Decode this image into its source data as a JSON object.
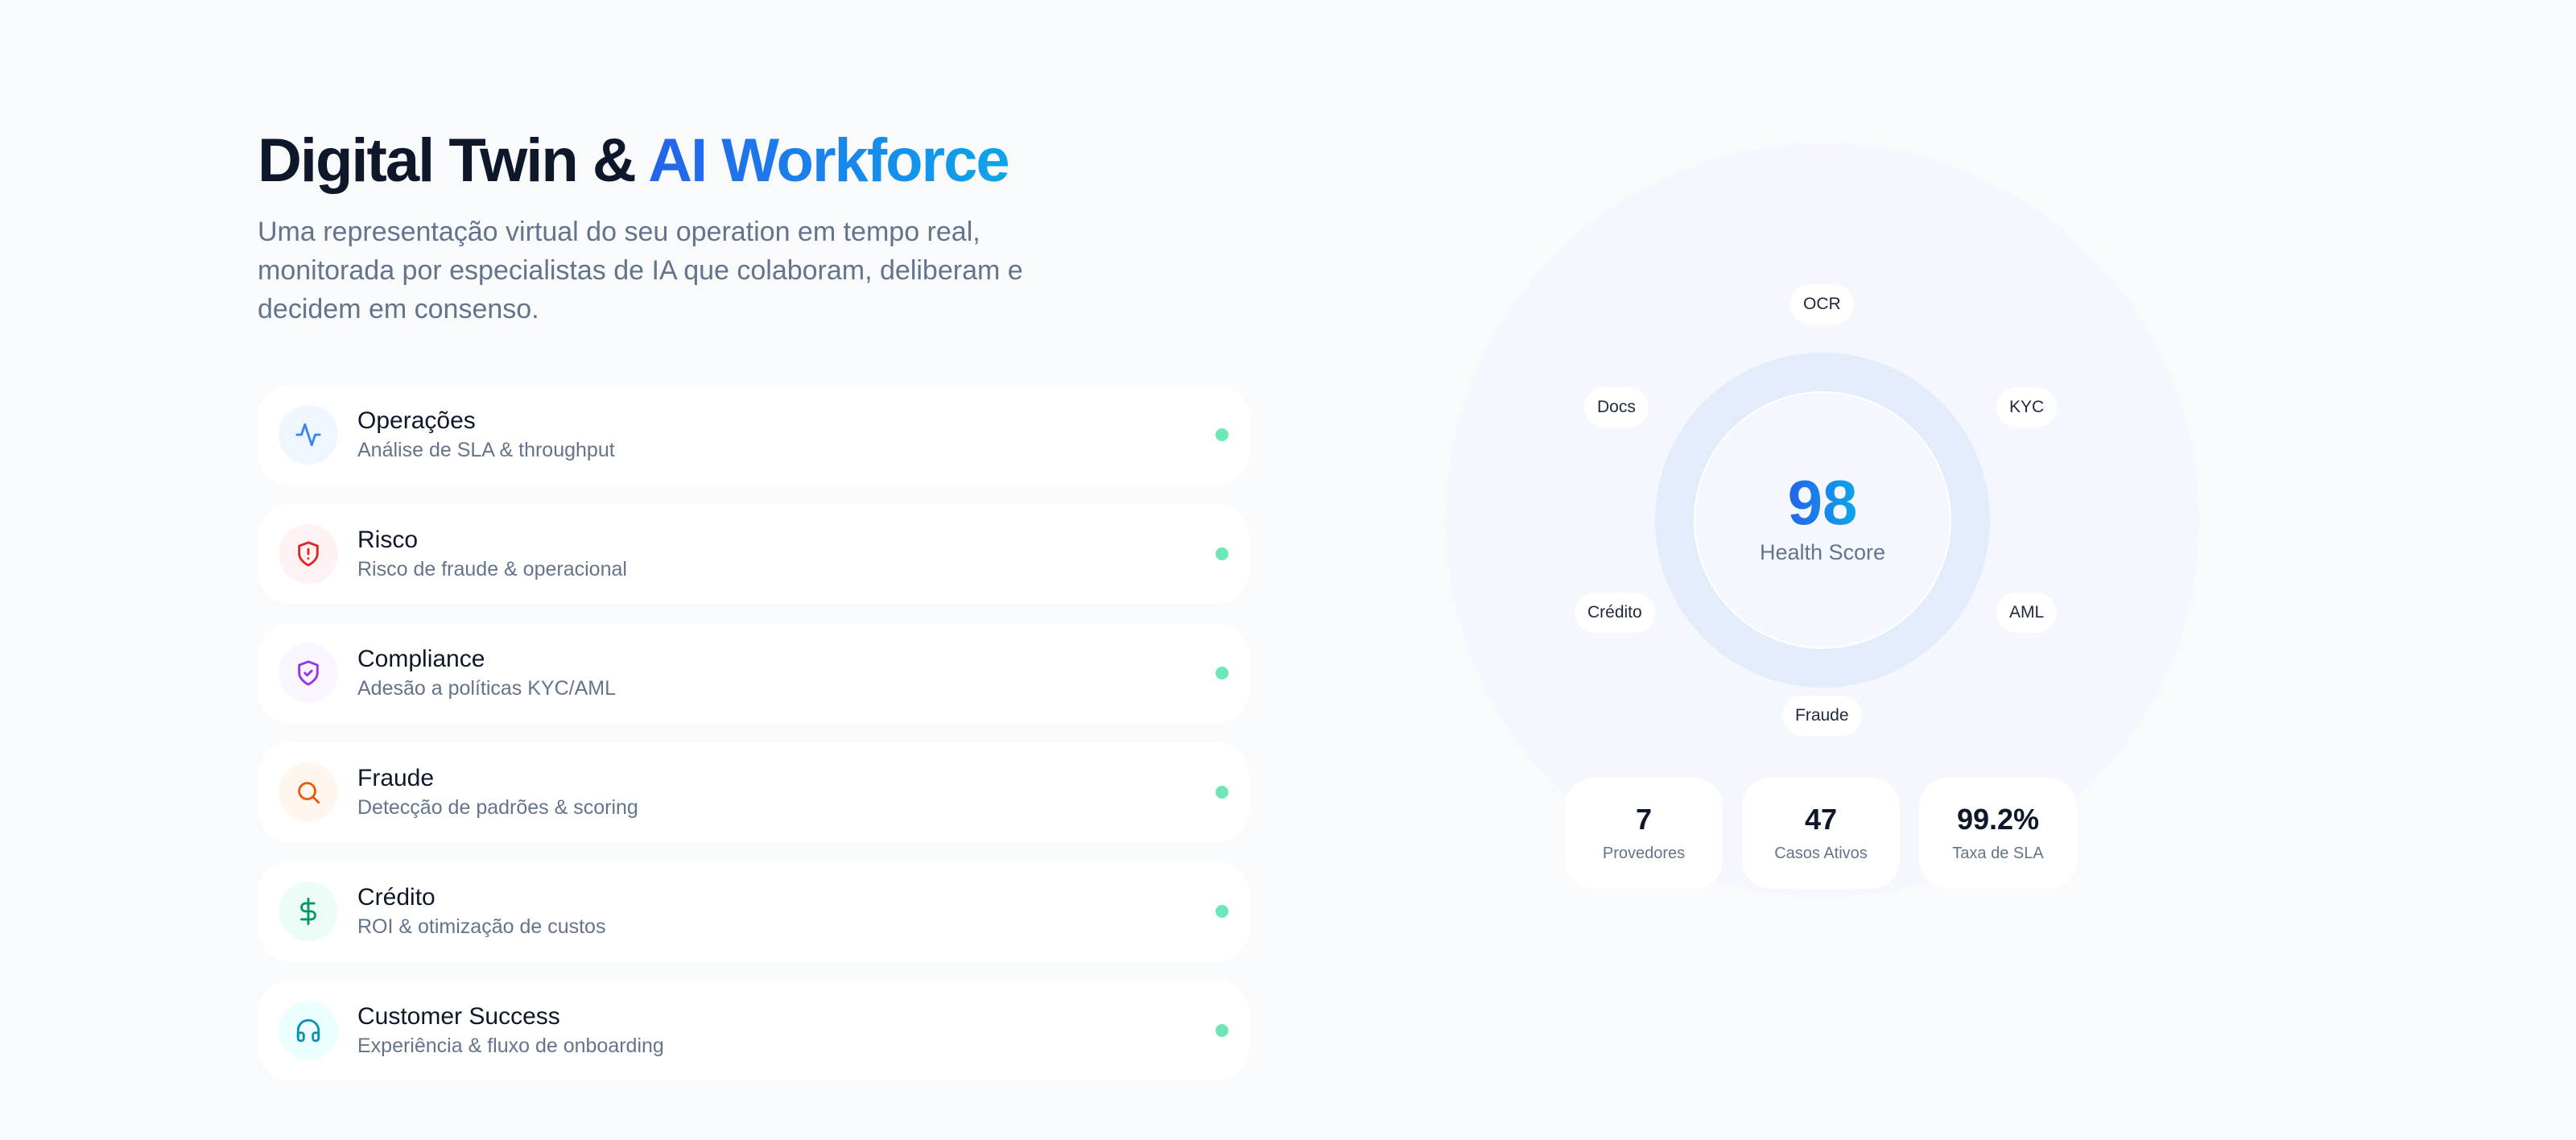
{
  "hero": {
    "title_main": "Digital Twin & ",
    "title_accent": "AI Workforce",
    "subtitle": "Uma representação virtual do seu operation em tempo real, monitorada por especialistas de IA que colaboram, deliberam e decidem em consenso."
  },
  "agents": [
    {
      "title": "Operações",
      "subtitle": "Análise de SLA & throughput",
      "icon": "activity-icon",
      "icon_color": "#3b82f6",
      "icon_bg": "#eff6ff",
      "status_color": "#6ee7b7"
    },
    {
      "title": "Risco",
      "subtitle": "Risco de fraude & operacional",
      "icon": "shield-alert-icon",
      "icon_color": "#dc2626",
      "icon_bg": "#fef2f2",
      "status_color": "#6ee7b7"
    },
    {
      "title": "Compliance",
      "subtitle": "Adesão a políticas KYC/AML",
      "icon": "shield-check-icon",
      "icon_color": "#9333ea",
      "icon_bg": "#faf5ff",
      "status_color": "#6ee7b7"
    },
    {
      "title": "Fraude",
      "subtitle": "Detecção de padrões & scoring",
      "icon": "search-icon",
      "icon_color": "#ea580c",
      "icon_bg": "#fff7ed",
      "status_color": "#6ee7b7"
    },
    {
      "title": "Crédito",
      "subtitle": "ROI & otimização de custos",
      "icon": "dollar-icon",
      "icon_color": "#059669",
      "icon_bg": "#ecfdf5",
      "status_color": "#6ee7b7"
    },
    {
      "title": "Customer Success",
      "subtitle": "Experiência & fluxo de onboarding",
      "icon": "headphones-icon",
      "icon_color": "#0891b2",
      "icon_bg": "#ecfeff",
      "status_color": "#6ee7b7"
    }
  ],
  "twin": {
    "score": "98",
    "score_label": "Health Score",
    "nodes": {
      "ocr": "OCR",
      "kyc": "KYC",
      "aml": "AML",
      "fraude": "Fraude",
      "credito": "Crédito",
      "docs": "Docs"
    }
  },
  "stats": [
    {
      "value": "7",
      "label": "Provedores"
    },
    {
      "value": "47",
      "label": "Casos Ativos"
    },
    {
      "value": "99.2%",
      "label": "Taxa de SLA"
    }
  ],
  "colors": {
    "accent_start": "#2563eb",
    "accent_end": "#0ea5e9",
    "status_online": "#6ee7b7"
  }
}
